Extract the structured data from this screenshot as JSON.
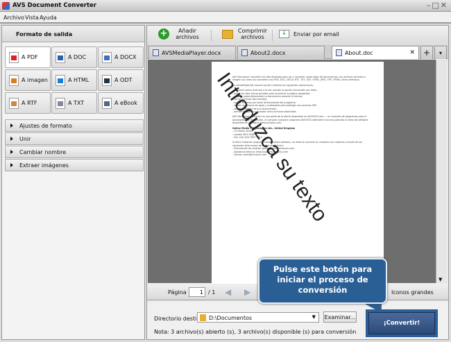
{
  "app": {
    "title": "AVS Document Converter"
  },
  "menu": [
    "Archivo",
    "Vista",
    "Ayuda"
  ],
  "left": {
    "header": "Formato de salida",
    "formats": [
      {
        "label": "A PDF",
        "color": "#d22"
      },
      {
        "label": "A DOC",
        "color": "#2a5fb0"
      },
      {
        "label": "A DOCX",
        "color": "#3f6fc8"
      },
      {
        "label": "A imagen",
        "color": "#e07a20"
      },
      {
        "label": "A HTML",
        "color": "#1a7fd8"
      },
      {
        "label": "A ODT",
        "color": "#234"
      },
      {
        "label": "A RTF",
        "color": "#c84"
      },
      {
        "label": "A TXT",
        "color": "#889"
      },
      {
        "label": "A eBook",
        "color": "#568"
      }
    ],
    "sections": [
      "Ajustes de formato",
      "Unir",
      "Cambiar nombre",
      "Extraer imágenes"
    ]
  },
  "toolbar": {
    "add": "Añadir archivos",
    "compress": "Comprimir archivos",
    "email": "Enviar por email"
  },
  "tabs": [
    "AVSMediaPlayer.docx",
    "About2.docx",
    "About.doc"
  ],
  "document": {
    "p1": "AVS Document Converter ha sido diseñado para ver y convertir varios tipos de documentos. Los archivos de texto e imagen así como los convierte a los PDF, DOC, DOCX, RTF, TXT, ODT, HTML, JPEG, TIFF, EPUB y otros formatos.",
    "p2": "La versatilidad del usuario ayuda a realizar las siguientes operaciones:",
    "list": [
      "- convertir varios archivos a la vez usando la opción Conversión por lotes;",
      "- pasar de vista iconos grandes para encontrar la página apropiada;",
      "- ampliar automáticamente su documento durante la lectura;",
      "- zip los archivos documentos;",
      "- enviar archivos por email directamente del programa;",
      "- añadir una marca de agua y contraseña para proteger sus archivos PDF;",
      "- cambiar nombre de sus documentos;",
      "- extraer imágenes y guardar como archivos separados."
    ],
    "p3": "AVS Document Converter es una parte de la oferta disponible en AVS4YOU.com — un conjunto de programas para el procesamiento multimedia. Al comprar cualquier programa AVS4YOU obtendrá el acceso gratuito al resto del software disponible en la página www.avs4you.com.",
    "company": "Online Media Technologies Ltd., United Kingdom",
    "address": [
      "- 23 Harley Street",
      "- London W1G 9QN",
      "- Fax: (44) 020 7637 9412"
    ],
    "p4": "Si tiene cualquier pregunta sobre nuestro software, no dude en ponerse en contacto con nosotros a través de las siguientes direcciones de correo electrónico:",
    "contacts": [
      "- Información de carácter general: info@avs4you.com",
      "- Asistencia técnica: http://support.avs4you.com",
      "- Ventas: sales@avs4you.com"
    ],
    "watermark": "Introduzca su texto"
  },
  "pager": {
    "label": "Página",
    "current": "1",
    "total": "/ 1",
    "view": "Iconos grandes"
  },
  "bottom": {
    "dest_label": "Directorio destino:",
    "dest_value": "D:\\Documentos",
    "browse": "Examinar...",
    "note": "Nota: 3 archivo(s) abierto (s), 3 archivo(s) disponible (s) para conversión",
    "convert": "¡Convertir!"
  },
  "tooltip": "Pulse este botón para iniciar el proceso de conversión"
}
